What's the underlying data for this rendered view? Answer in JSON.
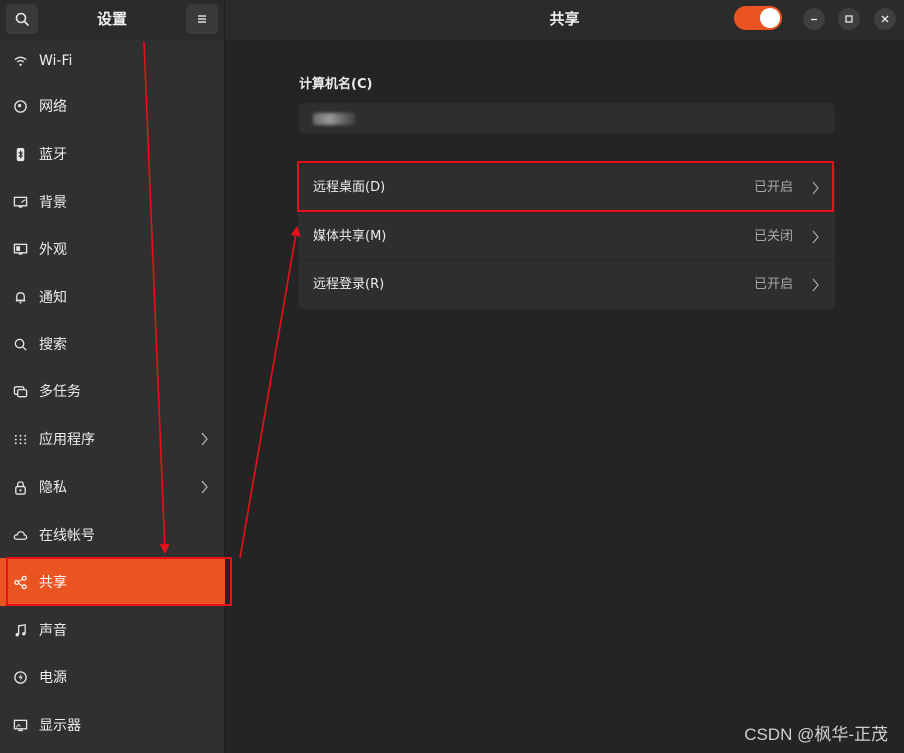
{
  "sidebar_header": {
    "title": "设置"
  },
  "main_header": {
    "title": "共享",
    "sharing_toggle": "on"
  },
  "sidebar": {
    "items": [
      {
        "label": "Wi-Fi",
        "icon": "wifi-icon"
      },
      {
        "label": "网络",
        "icon": "network-icon"
      },
      {
        "label": "蓝牙",
        "icon": "bluetooth-icon"
      },
      {
        "label": "背景",
        "icon": "background-icon"
      },
      {
        "label": "外观",
        "icon": "appearance-icon"
      },
      {
        "label": "通知",
        "icon": "bell-icon"
      },
      {
        "label": "搜索",
        "icon": "search-icon"
      },
      {
        "label": "多任务",
        "icon": "multitasking-icon"
      },
      {
        "label": "应用程序",
        "icon": "apps-grid-icon"
      },
      {
        "label": "隐私",
        "icon": "lock-icon"
      },
      {
        "label": "在线帐号",
        "icon": "cloud-icon"
      },
      {
        "label": "共享",
        "icon": "share-icon",
        "active": true
      },
      {
        "label": "声音",
        "icon": "music-note-icon"
      },
      {
        "label": "电源",
        "icon": "power-icon"
      },
      {
        "label": "显示器",
        "icon": "display-icon"
      }
    ]
  },
  "main": {
    "computer_name_label": "计算机名(C)",
    "rows": [
      {
        "label": "远程桌面(D)",
        "status": "已开启"
      },
      {
        "label": "媒体共享(M)",
        "status": "已关闭"
      },
      {
        "label": "远程登录(R)",
        "status": "已开启"
      }
    ]
  },
  "watermark": "CSDN @枫华-正茂",
  "colors": {
    "accent": "#e95420",
    "annotation": "#e8101a"
  }
}
